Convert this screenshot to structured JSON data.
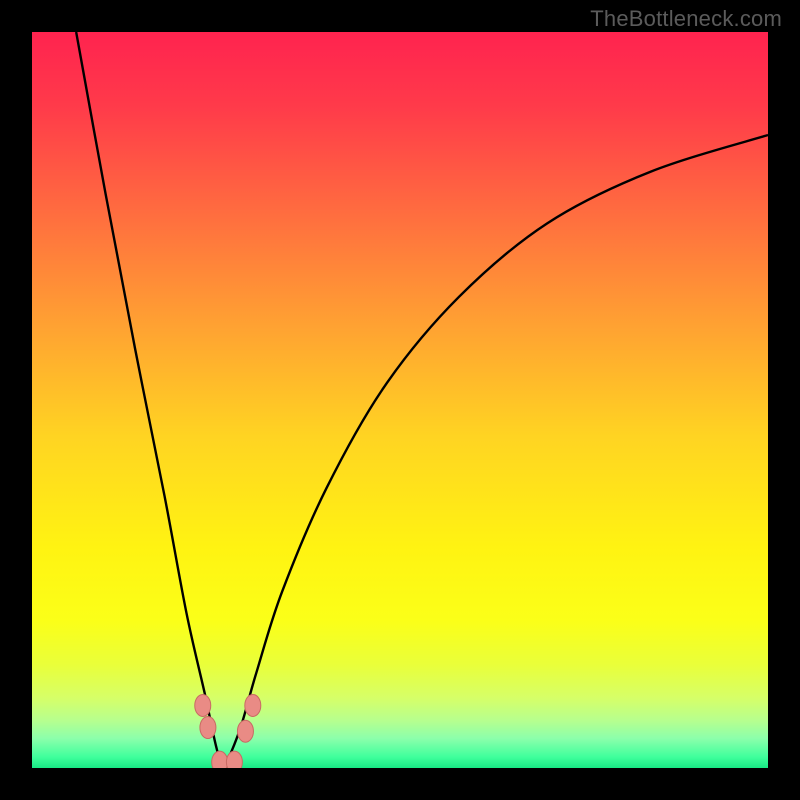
{
  "watermark": "TheBottleneck.com",
  "colors": {
    "background": "#000000",
    "gradient_stops": [
      {
        "offset": 0.0,
        "color": "#ff234f"
      },
      {
        "offset": 0.1,
        "color": "#ff3a4a"
      },
      {
        "offset": 0.25,
        "color": "#ff6e3f"
      },
      {
        "offset": 0.4,
        "color": "#ffa232"
      },
      {
        "offset": 0.55,
        "color": "#ffd422"
      },
      {
        "offset": 0.7,
        "color": "#fff312"
      },
      {
        "offset": 0.8,
        "color": "#fbff18"
      },
      {
        "offset": 0.86,
        "color": "#e9ff3a"
      },
      {
        "offset": 0.905,
        "color": "#d6ff68"
      },
      {
        "offset": 0.935,
        "color": "#b7ff8e"
      },
      {
        "offset": 0.96,
        "color": "#8bffab"
      },
      {
        "offset": 0.985,
        "color": "#3fff9c"
      },
      {
        "offset": 1.0,
        "color": "#18e884"
      }
    ],
    "curve": "#000000",
    "marker_fill": "#e98b85",
    "marker_stroke": "#c86a63"
  },
  "chart_data": {
    "type": "line",
    "title": "",
    "xlabel": "",
    "ylabel": "",
    "xlim": [
      0,
      100
    ],
    "ylim": [
      0,
      100
    ],
    "note": "Axes have no visible tick labels; values are estimated as percentages of the plot area. y=100 at top (red), y=0 at bottom (green). Curve is a V-shaped bottleneck profile with minimum near x≈26, y≈0.",
    "series": [
      {
        "name": "bottleneck-curve",
        "x": [
          6,
          10,
          14,
          18,
          21,
          23.5,
          25,
          26,
          27,
          28.5,
          30.5,
          34,
          40,
          48,
          58,
          70,
          84,
          100
        ],
        "y": [
          100,
          78,
          57,
          37,
          21,
          10,
          3,
          0,
          2,
          6,
          13,
          24,
          38,
          52,
          64,
          74,
          81,
          86
        ]
      }
    ],
    "markers": [
      {
        "name": "left-branch-marker-upper",
        "x": 23.2,
        "y": 8.5
      },
      {
        "name": "left-branch-marker-lower",
        "x": 23.9,
        "y": 5.5
      },
      {
        "name": "valley-marker-left",
        "x": 25.5,
        "y": 0.8
      },
      {
        "name": "valley-marker-right",
        "x": 27.5,
        "y": 0.8
      },
      {
        "name": "right-branch-marker-lower",
        "x": 29.0,
        "y": 5.0
      },
      {
        "name": "right-branch-marker-upper",
        "x": 30.0,
        "y": 8.5
      }
    ]
  }
}
